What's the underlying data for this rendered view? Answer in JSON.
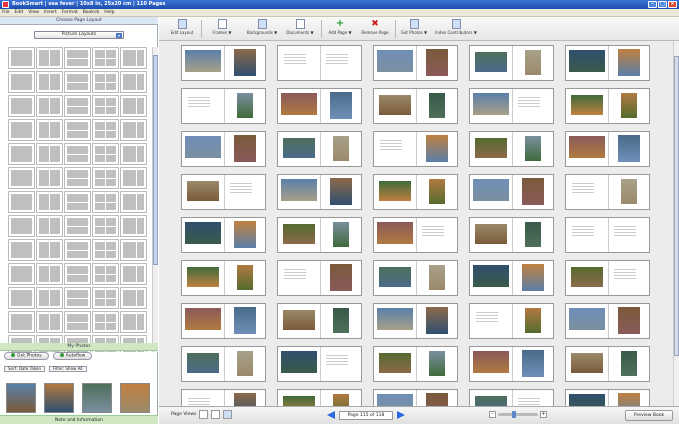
{
  "window": {
    "title": "BookSmart | sea fever | 10x8 in, 25x20 cm | 110 Pages"
  },
  "menu": [
    "File",
    "Edit",
    "View",
    "Insert",
    "Format",
    "Bookcb",
    "Help"
  ],
  "left_panel": {
    "header": "Choose Page Layout",
    "layout_select": "Picture Layouts",
    "my_photos_header": "My Photos",
    "get_photos_button": "Get Photos",
    "autoflow_button": "Autoflow",
    "sort_select": "Sort: Date Taken",
    "filter_select": "Filter: Show All",
    "notes_bar": "Note and Information"
  },
  "toolbar": {
    "edit_layout": "Edit Layout",
    "frames": "Frames ▼",
    "backgrounds": "Backgrounds ▼",
    "documents": "Documents ▼",
    "add_page": "Add Page ▼",
    "remove_page": "Remove Page",
    "get_photos": "Get Photos ▼",
    "index_contributors": "Index Contributors ▼"
  },
  "bottom_bar": {
    "page_views": "Page Views",
    "page_indicator": "Page 115 of 118",
    "preview_button": "Preview Book"
  },
  "thumbnail_colors": [
    "#5a7fa8",
    "#8c6a4a",
    "#3f6b3a",
    "#b07a40",
    "#6f8fb8",
    "#7a5a3a",
    "#4e6f5a",
    "#a8a08a",
    "#2f4f6f",
    "#c08040",
    "#556b2f",
    "#7b8fa0",
    "#8a5a5a",
    "#4a6a8a",
    "#9a8a6a",
    "#3a5a4a"
  ]
}
